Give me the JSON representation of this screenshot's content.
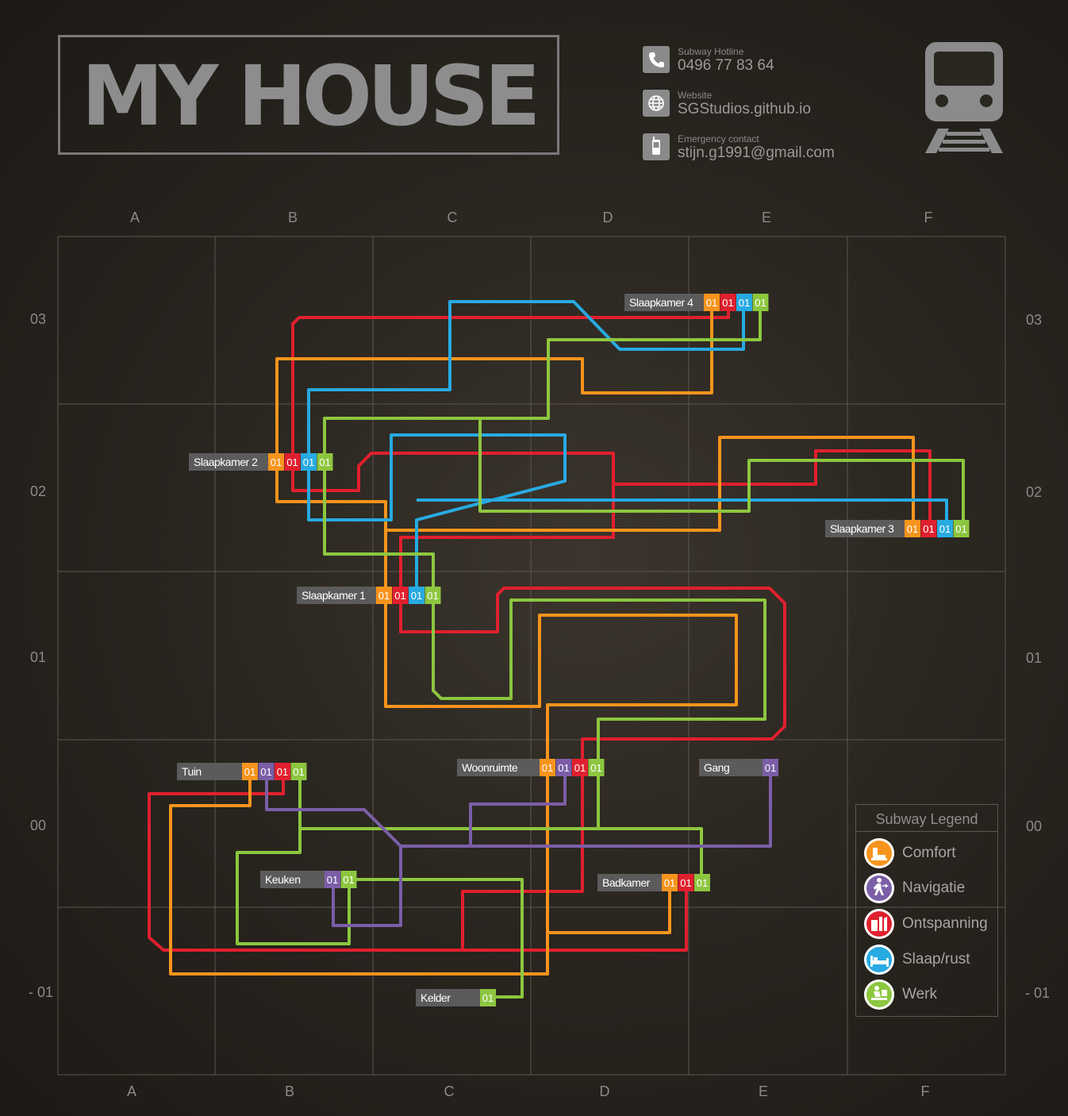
{
  "header": {
    "title": "MY HOUSE",
    "contacts": [
      {
        "label": "Subway Hotline",
        "value": "0496 77 83 64",
        "icon": "phone-icon"
      },
      {
        "label": "Website",
        "value": "SGStudios.github.io",
        "icon": "globe-icon"
      },
      {
        "label": "Emergency contact",
        "value": "stijn.g1991@gmail.com",
        "icon": "mobile-phone-icon"
      }
    ],
    "logo_icon": "train-icon"
  },
  "grid": {
    "columns": [
      "A",
      "B",
      "C",
      "D",
      "E",
      "F"
    ],
    "rows": [
      "03",
      "02",
      "01",
      "00",
      "-01"
    ]
  },
  "colors": {
    "comfort": "#f7941d",
    "navigatie": "#7b5ea7",
    "ontspanning": "#e0202e",
    "slaap": "#27aae1",
    "werk": "#8dc63f"
  },
  "stations": [
    {
      "name": "Slaapkamer 4",
      "lines": [
        "comfort",
        "ontspanning",
        "slaap",
        "werk"
      ],
      "badge": "01"
    },
    {
      "name": "Slaapkamer 2",
      "lines": [
        "comfort",
        "ontspanning",
        "slaap",
        "werk"
      ],
      "badge": "01"
    },
    {
      "name": "Slaapkamer 3",
      "lines": [
        "comfort",
        "ontspanning",
        "slaap",
        "werk"
      ],
      "badge": "01"
    },
    {
      "name": "Slaapkamer 1",
      "lines": [
        "comfort",
        "ontspanning",
        "slaap",
        "werk"
      ],
      "badge": "01"
    },
    {
      "name": "Tuin",
      "lines": [
        "comfort",
        "navigatie",
        "ontspanning",
        "werk"
      ],
      "badge": "01"
    },
    {
      "name": "Woonruimte",
      "lines": [
        "comfort",
        "navigatie",
        "ontspanning",
        "werk"
      ],
      "badge": "01"
    },
    {
      "name": "Gang",
      "lines": [
        "navigatie"
      ],
      "badge": "01"
    },
    {
      "name": "Keuken",
      "lines": [
        "navigatie",
        "werk"
      ],
      "badge": "01"
    },
    {
      "name": "Badkamer",
      "lines": [
        "comfort",
        "ontspanning",
        "werk"
      ],
      "badge": "01"
    },
    {
      "name": "Kelder",
      "lines": [
        "werk"
      ],
      "badge": "01"
    }
  ],
  "legend": {
    "title": "Subway Legend",
    "items": [
      {
        "label": "Comfort",
        "line": "comfort",
        "icon": "armchair-icon"
      },
      {
        "label": "Navigatie",
        "line": "navigatie",
        "icon": "walking-person-icon"
      },
      {
        "label": "Ontspanning",
        "line": "ontspanning",
        "icon": "leisure-icon"
      },
      {
        "label": "Slaap/rust",
        "line": "slaap",
        "icon": "bed-icon"
      },
      {
        "label": "Werk",
        "line": "werk",
        "icon": "desk-worker-icon"
      }
    ]
  }
}
